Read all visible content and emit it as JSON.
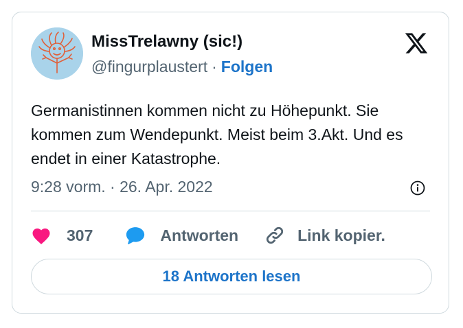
{
  "author": {
    "display_name": "MissTrelawny (sic!)",
    "handle": "@fingurplaustert",
    "separator": "·",
    "follow_label": "Folgen"
  },
  "tweet": {
    "text": "Germanistinnen kommen nicht zu Höhepunkt. Sie kommen zum Wendepunkt. Meist beim 3.Akt. Und es endet in einer Katastrophe.",
    "timestamp": "9:28 vorm. · 26. Apr. 2022"
  },
  "actions": {
    "like_count": "307",
    "reply_label": "Antworten",
    "copy_link_label": "Link kopier."
  },
  "footer": {
    "read_replies_label": "18 Antworten lesen"
  },
  "colors": {
    "link_blue": "#1d74c9",
    "like_pink": "#f91880",
    "reply_blue": "#1d9bf0",
    "secondary_text": "#536471",
    "border": "#cfd9de"
  },
  "icons": [
    "avatar-drawing",
    "x-logo-icon",
    "info-icon",
    "heart-icon",
    "reply-bubble-icon",
    "link-icon"
  ]
}
